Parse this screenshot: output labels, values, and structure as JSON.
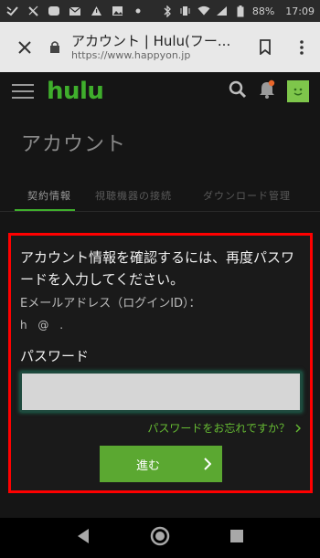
{
  "status_bar": {
    "battery": "88%",
    "time": "17:09"
  },
  "browser": {
    "title": "アカウント | Hulu(フー...",
    "url": "https://www.happyon.jp"
  },
  "header": {
    "logo": "hulu",
    "brand_color": "#3fae2c"
  },
  "page": {
    "title": "アカウント",
    "tabs": [
      {
        "label": "契約情報"
      },
      {
        "label": "視聴機器の接続"
      },
      {
        "label": "ダウンロード管理"
      }
    ]
  },
  "form": {
    "message": "アカウント情報を確認するには、再度パスワードを入力してください。",
    "email_label": "Eメールアドレス（ログインID）：",
    "email_value": "h  @     .",
    "password_label": "パスワード",
    "password_value": "",
    "forgot_link": "パスワードをお忘れですか？",
    "submit_label": "進む",
    "highlight_color": "#ff0000",
    "button_color": "#5ba831"
  }
}
